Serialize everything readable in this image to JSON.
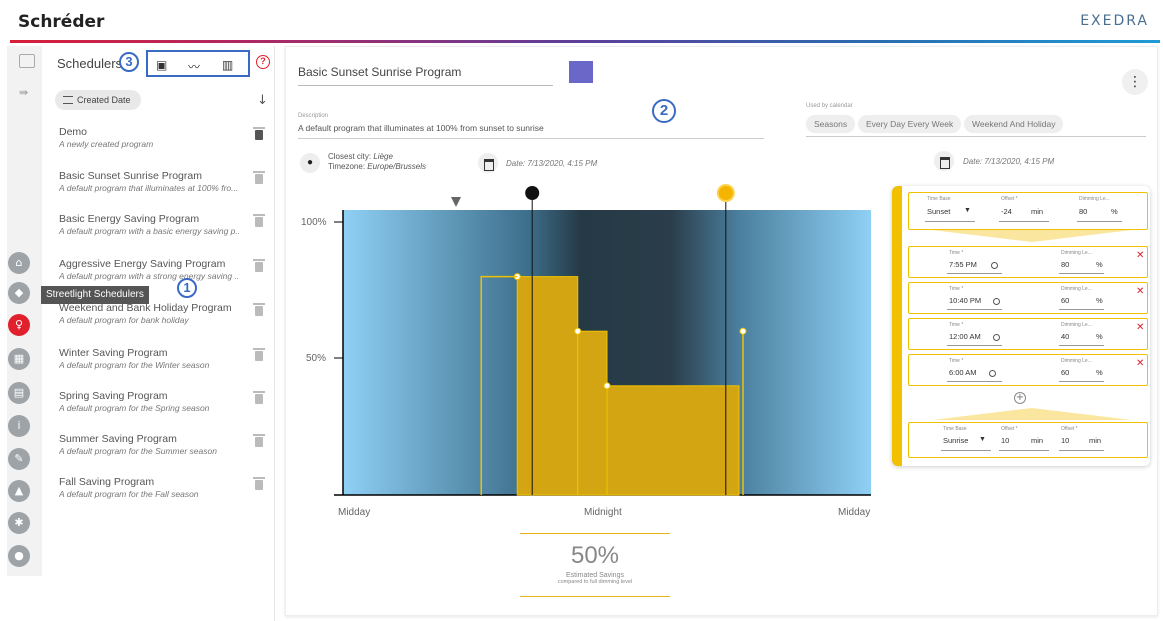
{
  "header": {
    "brand": "Schréder",
    "product": "EXEDRA"
  },
  "annotations": {
    "one": "1",
    "two": "2",
    "three": "3"
  },
  "schedulers": {
    "title": "Schedulers",
    "tooltip": "Streetlight Schedulers",
    "sort_label": "Created Date",
    "help_glyph": "?",
    "programs": [
      {
        "name": "Demo",
        "desc": "A newly created program"
      },
      {
        "name": "Basic Sunset Sunrise Program",
        "desc": "A default program that illuminates at 100% fro..."
      },
      {
        "name": "Basic Energy Saving Program",
        "desc": "A default program with a basic energy saving p..."
      },
      {
        "name": "Aggressive Energy Saving Program",
        "desc": "A default program with a strong energy saving ..."
      },
      {
        "name": "Weekend and Bank Holiday Program",
        "desc": "A default program for bank holiday"
      },
      {
        "name": "Winter Saving Program",
        "desc": "A default program for the Winter season"
      },
      {
        "name": "Spring Saving Program",
        "desc": "A default program for the Spring season"
      },
      {
        "name": "Summer Saving Program",
        "desc": "A default program for the Summer season"
      },
      {
        "name": "Fall Saving Program",
        "desc": "A default program for the Fall season"
      }
    ]
  },
  "program": {
    "name": "Basic Sunset Sunrise Program",
    "color": "#6a67c9",
    "description_label": "Description",
    "description": "A default program that illuminates at 100% from sunset to sunrise",
    "used_by_label": "Used by calendar",
    "used_by": [
      "Seasons",
      "Every Day Every Week",
      "Weekend And Holiday"
    ],
    "city_label": "Closest city:",
    "city": "Liège",
    "timezone_label": "Timezone:",
    "timezone": "Europe/Brussels",
    "date_left": "Date: 7/13/2020, 4:15 PM",
    "date_right": "Date: 7/13/2020, 4:15 PM"
  },
  "chart_data": {
    "type": "area",
    "ylabel_ticks": [
      "100%",
      "50%"
    ],
    "x_ticks": [
      "Midday",
      "Midnight",
      "Midday"
    ],
    "ylim": [
      0,
      100
    ],
    "x_range_hours": [
      12,
      36
    ],
    "steps": [
      {
        "from_hour": 19.92,
        "to_hour": 22.67,
        "level": 80
      },
      {
        "from_hour": 22.67,
        "to_hour": 24.0,
        "level": 60
      },
      {
        "from_hour": 24.0,
        "to_hour": 30.0,
        "level": 40
      }
    ],
    "sunset_hour": 20.6,
    "sunrise_hour": 29.4,
    "accent": "#f1c100"
  },
  "savings": {
    "value": "50%",
    "label": "Estimated Savings",
    "sub": "compared to full dimming level"
  },
  "editor": {
    "start": {
      "tb_label": "Time Base",
      "tb": "Sunset",
      "off_label": "Offset *",
      "off": "-24",
      "off_unit": "min",
      "dim_label": "Dimming Le...",
      "dim": "80",
      "dim_unit": "%"
    },
    "rows": [
      {
        "time_label": "Time *",
        "time": "7:55 PM",
        "dim_label": "Dimming Le...",
        "dim": "80",
        "unit": "%"
      },
      {
        "time_label": "Time *",
        "time": "10:40 PM",
        "dim_label": "Dimming Le...",
        "dim": "60",
        "unit": "%"
      },
      {
        "time_label": "Time *",
        "time": "12:00 AM",
        "dim_label": "Dimming Le...",
        "dim": "40",
        "unit": "%"
      },
      {
        "time_label": "Time *",
        "time": "6:00 AM",
        "dim_label": "Dimming Le...",
        "dim": "60",
        "unit": "%"
      }
    ],
    "end": {
      "tb_label": "Time Base",
      "tb": "Sunrise",
      "off_label": "Offset *",
      "off": "10",
      "off_unit": "min",
      "off2_label": "Offset *",
      "off2": "10",
      "off2_unit": "min"
    }
  }
}
